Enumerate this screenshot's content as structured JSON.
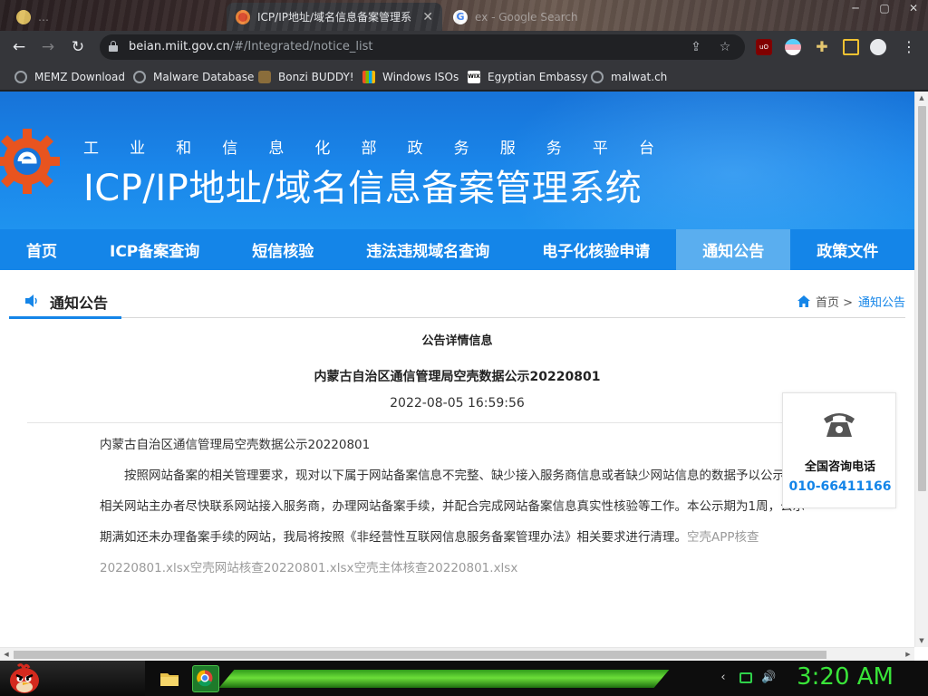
{
  "browser": {
    "tabs": [
      {
        "label": "…",
        "active": false
      },
      {
        "label": "ICP/IP地址/域名信息备案管理系",
        "active": true
      },
      {
        "label": "ex - Google Search",
        "active": false
      }
    ],
    "url_host": "beian.miit.gov.cn",
    "url_path": "/#/Integrated/notice_list",
    "bookmarks": [
      {
        "label": "MEMZ Download",
        "icon": "globe-icon"
      },
      {
        "label": "Malware Database",
        "icon": "globe-icon"
      },
      {
        "label": "Bonzi BUDDY!",
        "icon": "bonzi-icon"
      },
      {
        "label": "Windows ISOs",
        "icon": "windows-icon"
      },
      {
        "label": "Egyptian Embassy",
        "icon": "wix-icon"
      },
      {
        "label": "malwat.ch",
        "icon": "globe-icon"
      }
    ]
  },
  "site": {
    "subtitle_chars": [
      "工",
      "业",
      "和",
      "信",
      "息",
      "化",
      "部",
      "政",
      "务",
      "服",
      "务",
      "平",
      "台"
    ],
    "title": "ICP/IP地址/域名信息备案管理系统",
    "nav": [
      {
        "label": "首页",
        "active": false
      },
      {
        "label": "ICP备案查询",
        "active": false
      },
      {
        "label": "短信核验",
        "active": false
      },
      {
        "label": "违法违规域名查询",
        "active": false
      },
      {
        "label": "电子化核验申请",
        "active": false
      },
      {
        "label": "通知公告",
        "active": true
      },
      {
        "label": "政策文件",
        "active": false
      }
    ],
    "colors": {
      "header_blue": "#1a86ea",
      "nav_blue": "#1485e8",
      "nav_active": "#5aaeef"
    }
  },
  "section": {
    "title": "通知公告",
    "breadcrumb_home": "首页 >",
    "breadcrumb_current": "通知公告"
  },
  "notice": {
    "detail_label": "公告详情信息",
    "title": "内蒙古自治区通信管理局空壳数据公示20220801",
    "date": "2022-08-05 16:59:56",
    "heading_line": "内蒙古自治区通信管理局空壳数据公示20220801",
    "paragraph": "按照网站备案的相关管理要求，现对以下属于网站备案信息不完整、缺少接入服务商信息或者缺少网站信息的数据予以公示，请相关网站主办者尽快联系网站接入服务商，办理网站备案手续，并配合完成网站备案信息真实性核验等工作。本公示期为1周，公示期满如还未办理备案手续的网站，我局将按照《非经营性互联网信息服务备案管理办法》相关要求进行清理。",
    "attachments": [
      "空壳APP核查20220801.xlsx",
      "空壳网站核查20220801.xlsx",
      "空壳主体核查20220801.xlsx"
    ]
  },
  "hotline": {
    "label": "全国咨询电话",
    "number": "010-66411166"
  },
  "taskbar": {
    "clock": "3:20 AM"
  }
}
